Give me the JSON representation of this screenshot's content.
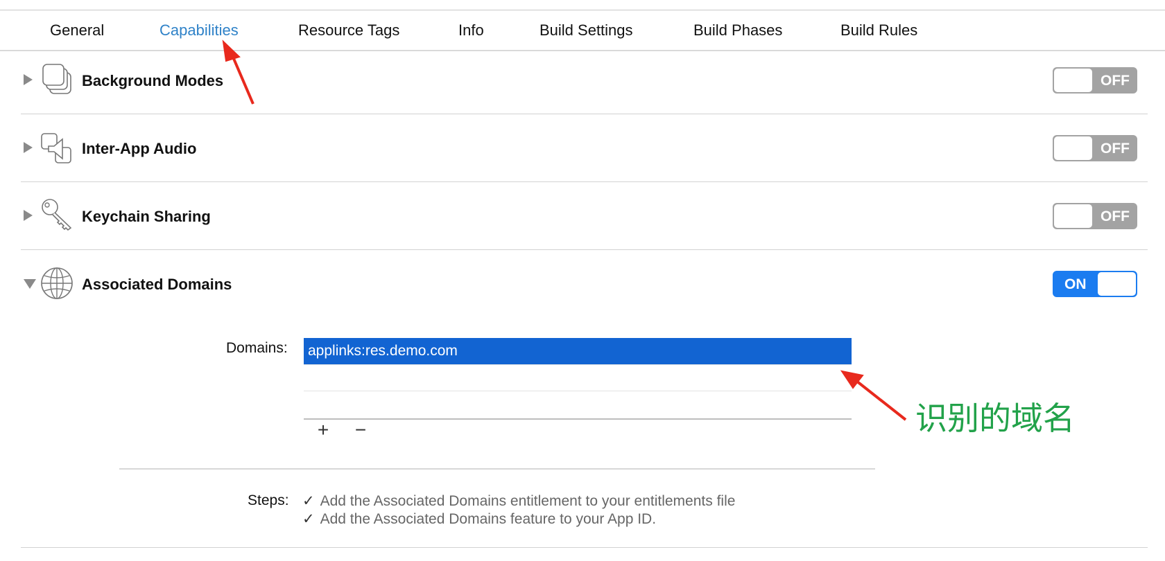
{
  "tabs": [
    {
      "label": "General",
      "active": false
    },
    {
      "label": "Capabilities",
      "active": true
    },
    {
      "label": "Resource Tags",
      "active": false
    },
    {
      "label": "Info",
      "active": false
    },
    {
      "label": "Build Settings",
      "active": false
    },
    {
      "label": "Build Phases",
      "active": false
    },
    {
      "label": "Build Rules",
      "active": false
    }
  ],
  "capabilities": [
    {
      "title": "Background Modes",
      "icon": "background-modes-icon",
      "state": "OFF",
      "expanded": false
    },
    {
      "title": "Inter-App Audio",
      "icon": "inter-app-audio-icon",
      "state": "OFF",
      "expanded": false
    },
    {
      "title": "Keychain Sharing",
      "icon": "key-icon",
      "state": "OFF",
      "expanded": false
    },
    {
      "title": "Associated Domains",
      "icon": "globe-icon",
      "state": "ON",
      "expanded": true
    }
  ],
  "associated_domains": {
    "domains_label": "Domains:",
    "domains": [
      "applinks:res.demo.com"
    ],
    "add_label": "+",
    "remove_label": "−",
    "steps_label": "Steps:",
    "steps": [
      "Add the Associated Domains entitlement to your entitlements file",
      "Add the Associated Domains feature to your App ID."
    ]
  },
  "annotation": {
    "text": "识别的域名",
    "color": "#22a24a",
    "arrow_color": "#e8291d"
  },
  "colors": {
    "active_tab": "#2f82c8",
    "toggle_on": "#1b7cf0",
    "toggle_off": "#a3a3a3",
    "selection": "#1264d2"
  }
}
